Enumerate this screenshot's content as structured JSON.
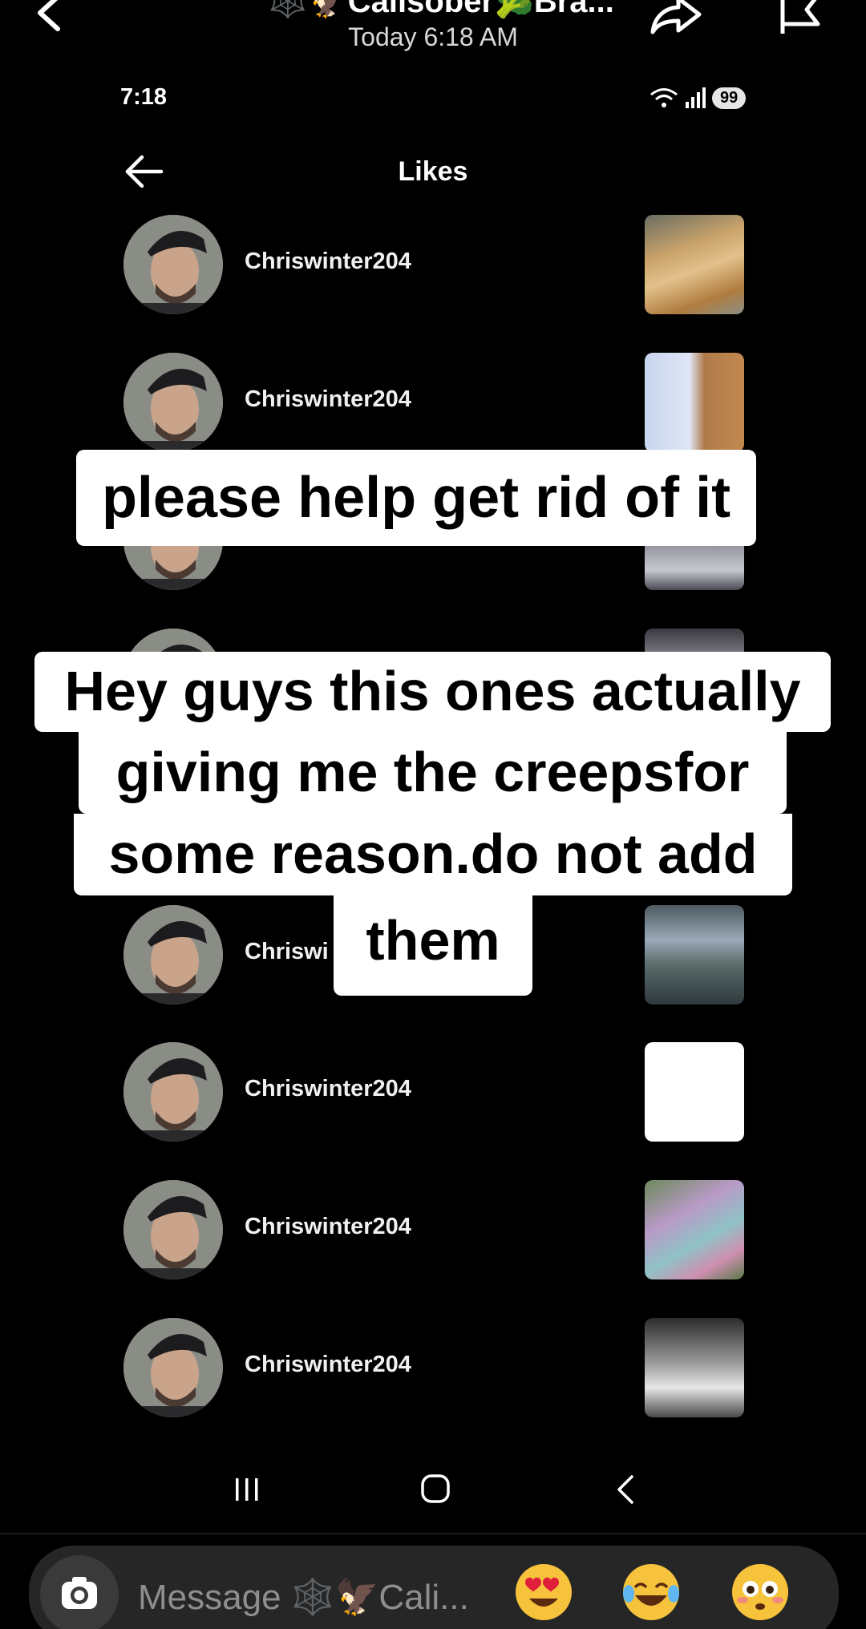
{
  "dm_header": {
    "title": "🕸️🦅Calisober🥦Bra...",
    "timestamp": "Today 6:18 AM"
  },
  "status_bar": {
    "time": "7:18",
    "battery": "99"
  },
  "likes_screen": {
    "title": "Likes",
    "rows": [
      {
        "username": "Chriswinter204",
        "thumb_icon": "flatbread-plate-photo"
      },
      {
        "username": "Chriswinter204",
        "thumb_icon": "product-bottle-photo"
      },
      {
        "username": "",
        "thumb_icon": "portrait-photo"
      },
      {
        "username": "",
        "thumb_icon": "text-poster-photo"
      },
      {
        "username": "Chriswi",
        "thumb_icon": "geese-on-pond-photo"
      },
      {
        "username": "Chriswinter204",
        "thumb_icon": "blank-white-photo"
      },
      {
        "username": "Chriswinter204",
        "thumb_icon": "tattoo-arm-photo"
      },
      {
        "username": "Chriswinter204",
        "thumb_icon": "woman-quote-photo"
      }
    ]
  },
  "captions": {
    "line1": "please help get rid of it",
    "line2a": "Hey guys this ones actually",
    "line2b": "giving me the creepsfor",
    "line2c": "some reason.do not add",
    "line2d": "them"
  },
  "message_bar": {
    "placeholder": "Message 🕸️🦅Cali...",
    "quick_reactions": [
      "heart-eyes-emoji",
      "tears-of-joy-emoji",
      "flushed-face-emoji"
    ]
  },
  "colors": {
    "background": "#000000",
    "caption_bg": "#ffffff",
    "message_bar_bg": "#262626"
  }
}
